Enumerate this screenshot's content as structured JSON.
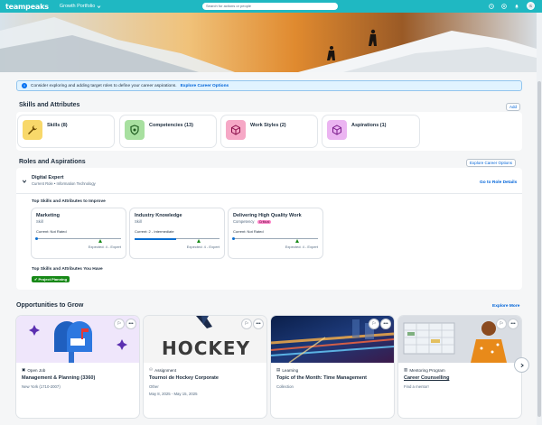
{
  "header": {
    "logo": "teampeaks",
    "nav_title": "Growth Portfolio",
    "search_placeholder": "Search for actions or people",
    "avatar_initials": "S"
  },
  "info_strip": {
    "text": "Consider exploring and adding target roles to define your career aspirations.",
    "link": "Explore Career Options"
  },
  "skills": {
    "title": "Skills and Attributes",
    "add_label": "Add",
    "cards": [
      {
        "label": "Skills (8)",
        "icon": "wrench-icon",
        "color": "#f8d86a"
      },
      {
        "label": "Competencies (13)",
        "icon": "shield-icon",
        "color": "#a8e0a0"
      },
      {
        "label": "Work Styles (2)",
        "icon": "cube-icon",
        "color": "#f6a8c6"
      },
      {
        "label": "Aspirations (1)",
        "icon": "cube-icon",
        "color": "#ebb4f1"
      }
    ]
  },
  "roles": {
    "title": "Roles and Aspirations",
    "explore_label": "Explore Career Options",
    "role_title": "Digital Expert",
    "role_sub": "Current Role • Information Technology",
    "go_to_role": "Go to Role Details",
    "improve_title": "Top Skills and Attributes to Improve",
    "have_title": "Top Skills and Attributes You Have",
    "have_tag": "Project Planning",
    "attributes": [
      {
        "name": "Marketing",
        "type": "Skill",
        "critical": "",
        "current": "Current: Not Rated",
        "current_level": 0,
        "expected": "Expected: 4 - Expert",
        "expected_level": 4
      },
      {
        "name": "Industry Knowledge",
        "type": "Skill",
        "critical": "",
        "current": "Current: 2 - Intermediate",
        "current_level": 2,
        "expected": "Expected: 4 - Expert",
        "expected_level": 4
      },
      {
        "name": "Delivering High Quality Work",
        "type": "Competency",
        "critical": "Critical",
        "current": "Current: Not Rated",
        "current_level": 0,
        "expected": "Expected: 4 - Expert",
        "expected_level": 4
      }
    ]
  },
  "opportunities": {
    "title": "Opportunities to Grow",
    "explore_more": "Explore More",
    "cards": [
      {
        "type": "Open Job",
        "title": "Management & Planning (3360)",
        "sub": "New York (1710-2007)",
        "icon": "briefcase-icon"
      },
      {
        "type": "Assignment",
        "title": "Tournoi de Hockey Corporate",
        "sub": "Other",
        "sub2": "May 8, 2025 - May 15, 2025",
        "icon": "people-icon",
        "image_text": "HOCKEY"
      },
      {
        "type": "Learning",
        "title": "Topic of the Month: Time Management",
        "sub": "Collection",
        "icon": "learning-icon"
      },
      {
        "type": "Mentoring Program",
        "title": "Career Counselling",
        "sub": "Find a mentor!",
        "icon": "mentor-icon"
      }
    ]
  }
}
